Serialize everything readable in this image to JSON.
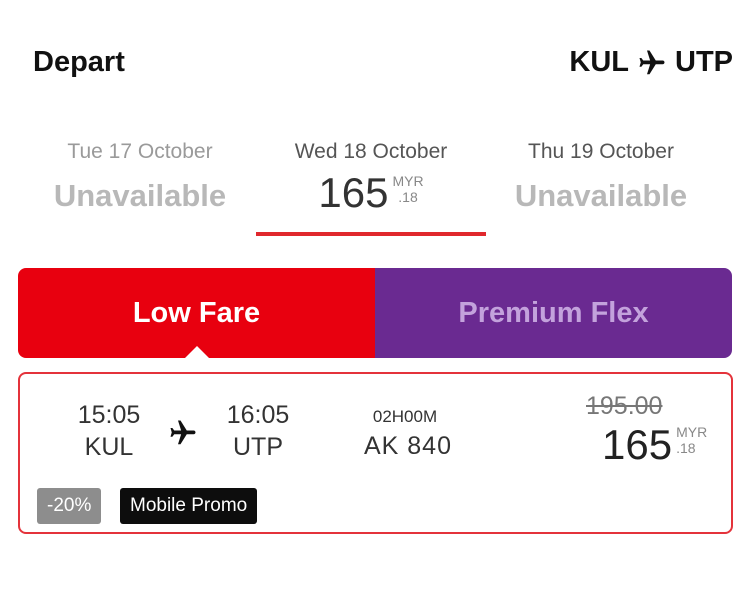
{
  "header": {
    "title": "Depart",
    "route": {
      "from": "KUL",
      "to": "UTP",
      "icon": "airplane-icon"
    }
  },
  "dates": [
    {
      "label": "Tue 17 October",
      "status": "Unavailable"
    },
    {
      "label": "Wed 18 October",
      "price_main": "165",
      "currency": "MYR",
      "cents": ".18",
      "selected": true
    },
    {
      "label": "Thu 19 October",
      "status": "Unavailable"
    }
  ],
  "fare_tabs": [
    {
      "label": "Low Fare",
      "selected": true,
      "color": "#e8000f"
    },
    {
      "label": "Premium Flex",
      "selected": false,
      "color": "#6a2a91"
    }
  ],
  "flight": {
    "depart_time": "15:05",
    "depart_code": "KUL",
    "arrive_time": "16:05",
    "arrive_code": "UTP",
    "duration": "02H00M",
    "flight_number": "AK  840",
    "old_price": "195.00",
    "price_main": "165",
    "currency": "MYR",
    "cents": ".18",
    "badges": {
      "discount": "-20%",
      "promo": "Mobile Promo"
    }
  },
  "colors": {
    "accent": "#e0282d",
    "premium": "#6a2a91"
  }
}
